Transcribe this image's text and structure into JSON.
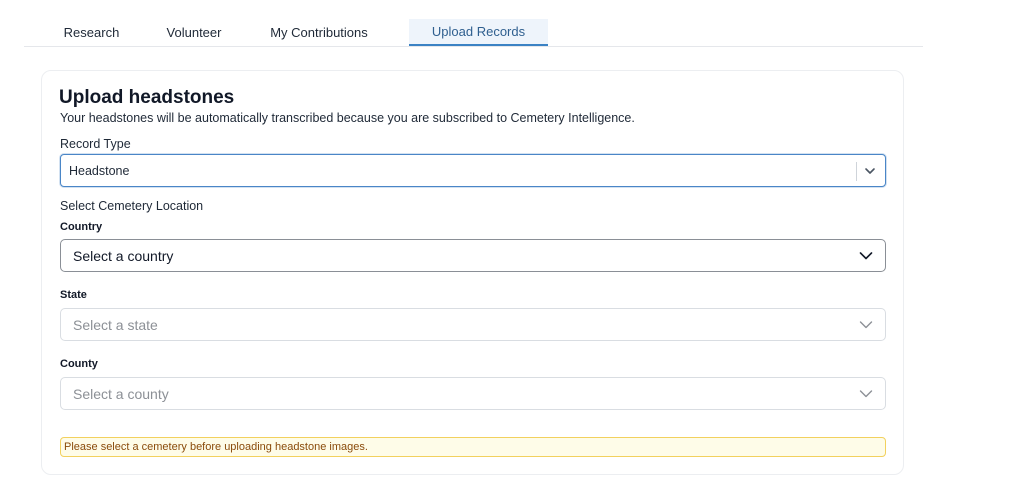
{
  "tabs": [
    {
      "label": "Research"
    },
    {
      "label": "Volunteer"
    },
    {
      "label": "My Contributions"
    },
    {
      "label": "Upload Records",
      "active": true
    }
  ],
  "card": {
    "title": "Upload headstones",
    "subtitle": "Your headstones will be automatically transcribed because you are subscribed to Cemetery Intelligence.",
    "record_type": {
      "label": "Record Type",
      "value": "Headstone"
    },
    "location_heading": "Select Cemetery Location",
    "country": {
      "label": "Country",
      "placeholder": "Select a country",
      "enabled": true
    },
    "state": {
      "label": "State",
      "placeholder": "Select a state",
      "enabled": false
    },
    "county": {
      "label": "County",
      "placeholder": "Select a county",
      "enabled": false
    },
    "warning": "Please select a cemetery before uploading headstone images."
  },
  "colors": {
    "active_tab_text": "#2f5f8f",
    "active_tab_underline": "#3b82c4",
    "focus_border": "#4a86c7",
    "warning_bg": "#fefce8",
    "warning_border": "#f2d15e",
    "warning_text": "#8a4b0b"
  },
  "icons": {
    "record_type_chevron": "chevron-down-icon",
    "dropdown_chevron": "chevron-down-icon"
  }
}
